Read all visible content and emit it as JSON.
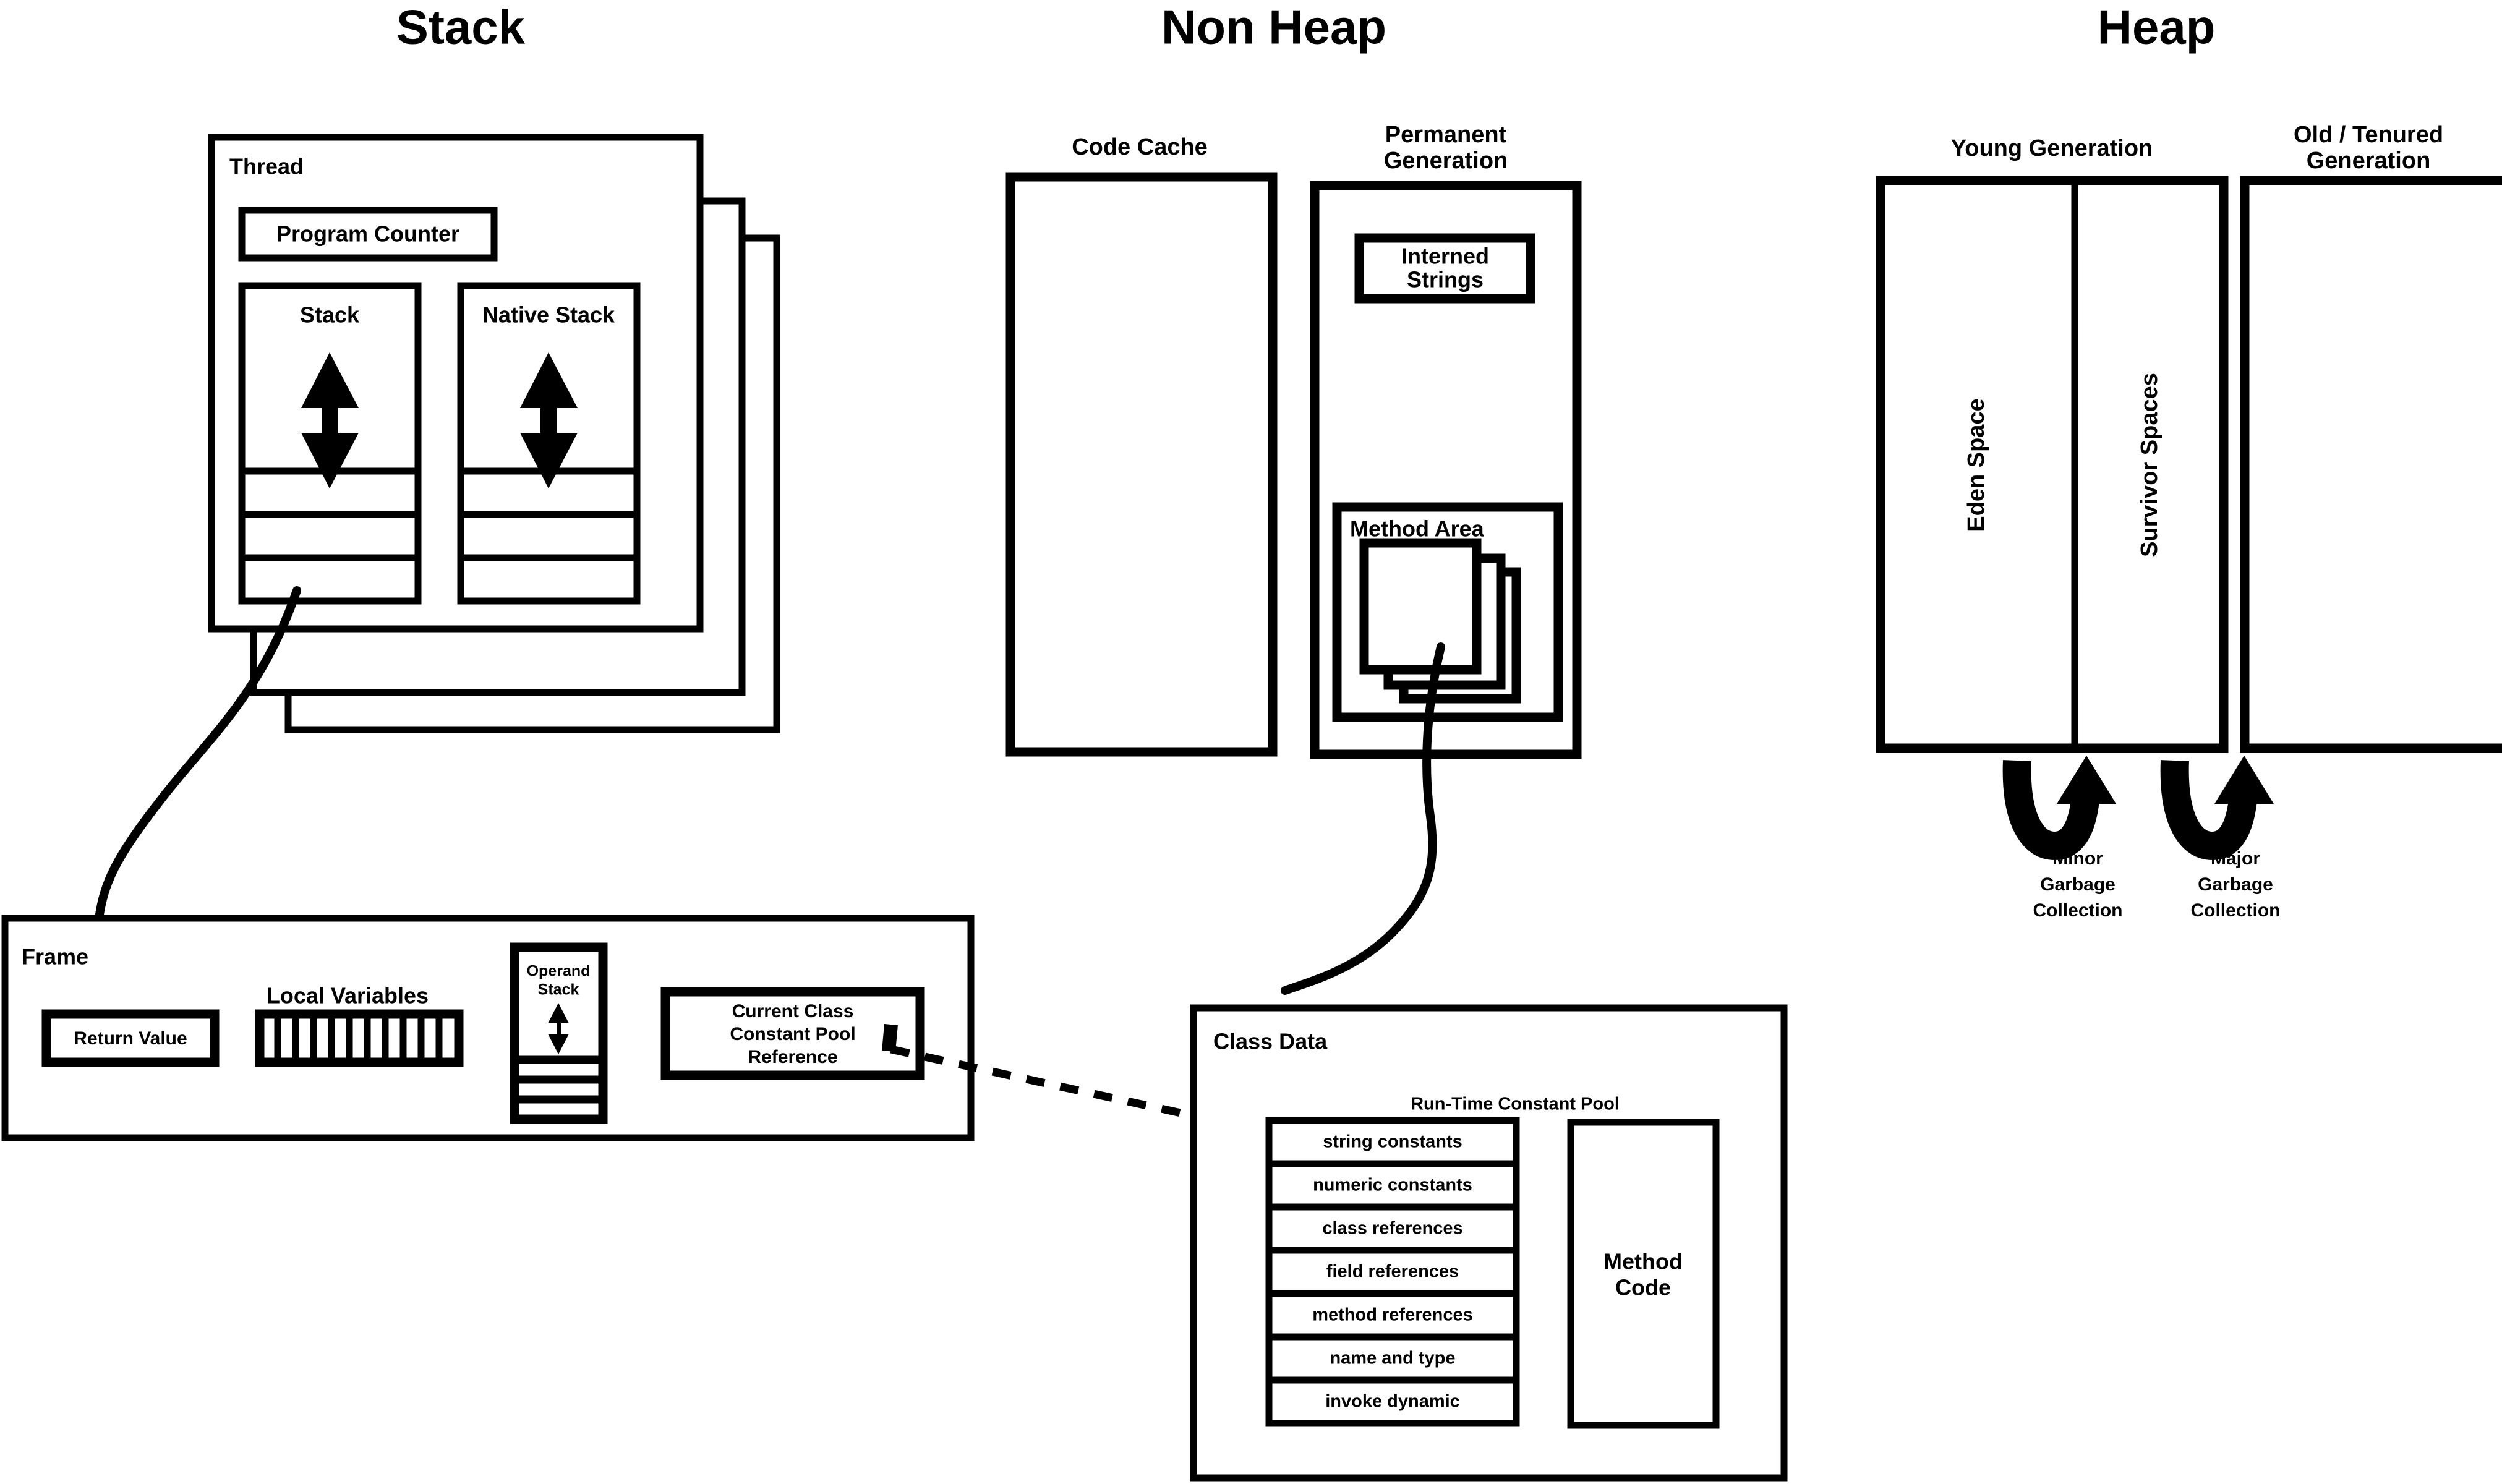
{
  "titles": {
    "stack": "Stack",
    "non_heap": "Non Heap",
    "heap": "Heap"
  },
  "stack_section": {
    "thread_label": "Thread",
    "program_counter_label": "Program Counter",
    "stack_label": "Stack",
    "native_stack_label": "Native Stack",
    "thread_copies": 3,
    "stack_frame_slots": 3,
    "native_stack_frame_slots": 3
  },
  "frame_section": {
    "frame_label": "Frame",
    "return_value_label": "Return Value",
    "local_variables_label": "Local Variables",
    "local_variable_slots": 11,
    "operand_stack_label_line1": "Operand",
    "operand_stack_label_line2": "Stack",
    "operand_stack_slots": 3,
    "constant_pool_ref_line1": "Current Class",
    "constant_pool_ref_line2": "Constant Pool",
    "constant_pool_ref_line3": "Reference"
  },
  "non_heap_section": {
    "code_cache_label": "Code Cache",
    "permanent_generation_line1": "Permanent",
    "permanent_generation_line2": "Generation",
    "interned_strings_line1": "Interned",
    "interned_strings_line2": "Strings",
    "method_area_label": "Method Area",
    "method_area_class_copies": 3
  },
  "class_data_section": {
    "class_data_label": "Class Data",
    "run_time_constant_pool_label": "Run-Time Constant Pool",
    "constant_pool_entries": [
      "string constants",
      "numeric constants",
      "class references",
      "field references",
      "method references",
      "name and type",
      "invoke dynamic"
    ],
    "method_code_line1": "Method",
    "method_code_line2": "Code"
  },
  "heap_section": {
    "young_generation_label": "Young Generation",
    "old_tenured_line1": "Old / Tenured",
    "old_tenured_line2": "Generation",
    "eden_space_label": "Eden Space",
    "survivor_spaces_label": "Survivor Spaces",
    "minor_gc_line1": "Minor",
    "minor_gc_line2": "Garbage",
    "minor_gc_line3": "Collection",
    "major_gc_line1": "Major",
    "major_gc_line2": "Garbage",
    "major_gc_line3": "Collection"
  },
  "colors": {
    "stroke": "#000000",
    "fill": "#ffffff"
  }
}
